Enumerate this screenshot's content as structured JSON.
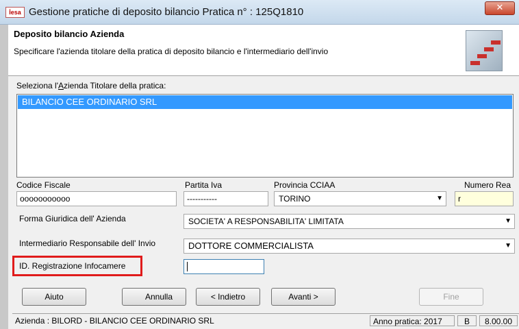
{
  "window": {
    "app_icon_text": "İesa",
    "title": "Gestione pratiche di deposito bilancio Pratica n° :  125Q1810",
    "close_glyph": "✕"
  },
  "header": {
    "title": "Deposito bilancio Azienda",
    "description": "Specificare l'azienda titolare della pratica di deposito bilancio e l'intermediario dell'invio"
  },
  "company_select": {
    "label_pre": "Seleziona l'",
    "label_underlined": "A",
    "label_post": "zienda Titolare della pratica:",
    "items": [
      "BILANCIO CEE ORDINARIO SRL"
    ],
    "selected_index": 0
  },
  "codice_fiscale": {
    "label": "Codice Fiscale",
    "value": "ooooooooooo"
  },
  "partita_iva": {
    "label": "Partita Iva",
    "value": "-----------"
  },
  "provincia": {
    "label": "Provincia CCIAA",
    "value": "TORINO"
  },
  "numero_rea": {
    "label": "Numero Rea",
    "value": "r"
  },
  "forma_giuridica": {
    "label": "Forma Giuridica dell' Azienda",
    "value": "SOCIETA' A RESPONSABILITA' LIMITATA"
  },
  "intermediario": {
    "label": "Intermediario Responsabile dell' Invio",
    "value": "DOTTORE COMMERCIALISTA"
  },
  "id_registrazione": {
    "label": "ID. Registrazione Infocamere",
    "value": ""
  },
  "buttons": {
    "help": "Aiuto",
    "cancel": "Annulla",
    "back": "< Indietro",
    "next": "Avanti >",
    "finish": "Fine"
  },
  "status": {
    "company": "Azienda : BILORD - BILANCIO CEE ORDINARIO SRL",
    "year": "Anno pratica: 2017",
    "flag": "B",
    "version": "8.00.00"
  },
  "colors": {
    "selection": "#3399ff",
    "highlight_border": "#e01b1b",
    "rea_field_bg": "#ffffdd"
  }
}
